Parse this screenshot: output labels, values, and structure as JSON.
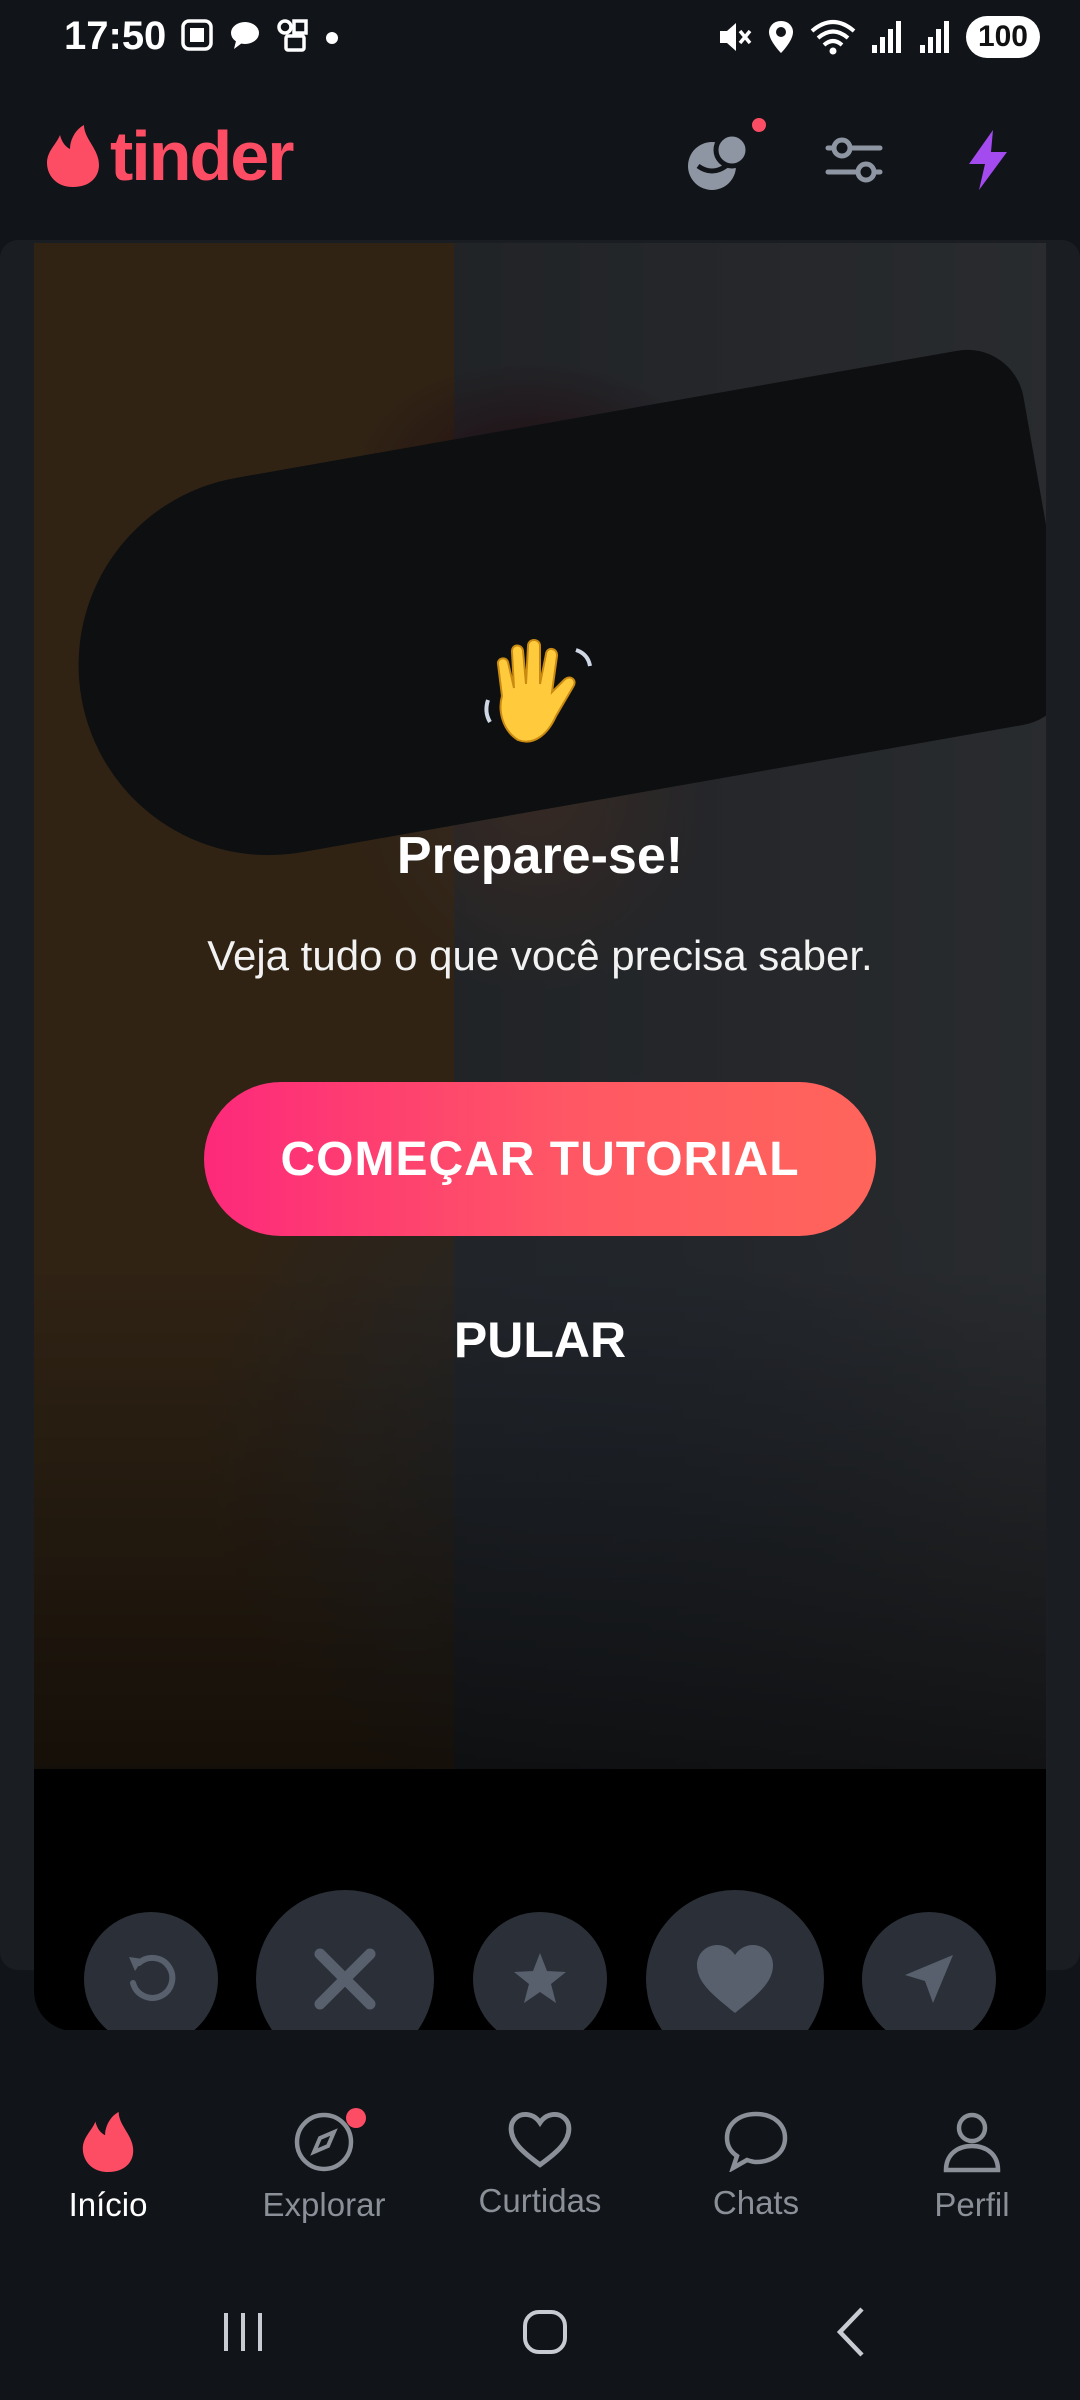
{
  "status_bar": {
    "time": "17:50",
    "battery": "100",
    "icons_left": [
      "screenshot-icon",
      "chat-bubble-icon",
      "cast-icon",
      "dot-icon"
    ],
    "icons_right": [
      "mute-icon",
      "location-icon",
      "wifi-icon",
      "signal-icon",
      "signal-icon"
    ]
  },
  "header": {
    "logo_text": "tinder",
    "icons": [
      "matches-icon",
      "filters-icon",
      "boost-icon"
    ],
    "colors": {
      "brand": "#fd4d64",
      "boost": "#a44bf0"
    }
  },
  "tutorial": {
    "title": "Prepare-se!",
    "subtitle": "Veja tudo o que você precisa saber.",
    "start_button": "COMEÇAR TUTORIAL",
    "skip_button": "PULAR"
  },
  "actions": [
    "rewind-icon",
    "nope-icon",
    "super-like-icon",
    "like-icon",
    "send-icon"
  ],
  "bottom_nav": {
    "items": [
      {
        "label": "Início",
        "icon": "flame-icon",
        "active": true
      },
      {
        "label": "Explorar",
        "icon": "compass-icon",
        "active": false
      },
      {
        "label": "Curtidas",
        "icon": "heart-icon",
        "active": false
      },
      {
        "label": "Chats",
        "icon": "chat-icon",
        "active": false
      },
      {
        "label": "Perfil",
        "icon": "person-icon",
        "active": false
      }
    ]
  },
  "system_nav": [
    "recents-icon",
    "home-icon",
    "back-icon"
  ]
}
